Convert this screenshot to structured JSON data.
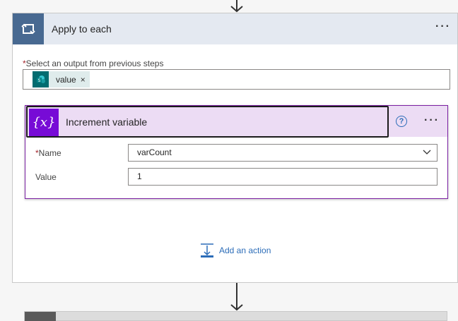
{
  "apply_to_each": {
    "title": "Apply to each",
    "more_label": "···",
    "select_label": "Select an output from previous steps",
    "required_mark": "*",
    "token": {
      "text": "value",
      "remove": "×",
      "icon": "sharepoint-icon"
    }
  },
  "increment_variable": {
    "title": "Increment variable",
    "icon_glyph": "{x}",
    "help_glyph": "?",
    "more_label": "···",
    "fields": {
      "name_label": "Name",
      "name_value": "varCount",
      "value_label": "Value",
      "value_value": "1"
    }
  },
  "add_action": {
    "label": "Add an action",
    "icon": "add-action-icon"
  },
  "colors": {
    "apply_header": "#e4e9f1",
    "apply_icon": "#486991",
    "inc_header": "#ecdcf4",
    "inc_icon": "#770bd6",
    "link": "#2b6cb8"
  }
}
